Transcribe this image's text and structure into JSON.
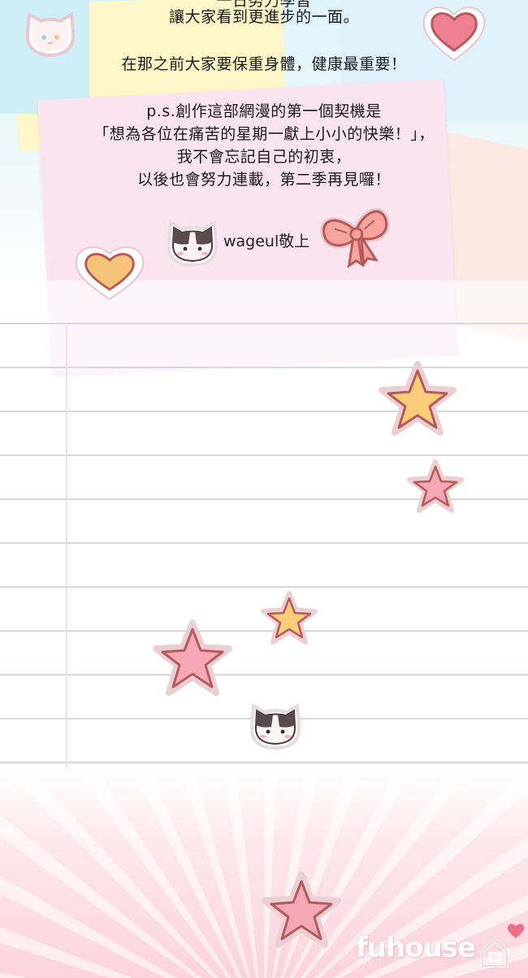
{
  "message": {
    "cut_line": "一日努力學習",
    "line1": "讓大家看到更進步的一面。",
    "line2": "在那之前大家要保重身體，健康最重要！",
    "line3": "p.s.創作這部網漫的第一個契機是",
    "line4": "「想為各位在痛苦的星期一獻上小小的快樂！」，",
    "line5": "我不會忘記自己的初衷，",
    "line6": "以後也會努力連載，第二季再見囉！",
    "signature": "wageul敬上"
  },
  "watermark": {
    "text": "fuhouse"
  },
  "colors": {
    "text": "#1a1a1a",
    "heart_pink": "#ef7f93",
    "heart_orange": "#f6c478",
    "star_yellow": "#f9cd7a",
    "star_pink": "#f6a9b5",
    "sticker_outline": "#b65a5a",
    "paper_line": "#d6d6e4",
    "note_pink": "#f9e4f0"
  },
  "stickers": [
    {
      "icon": "white-cat-face-icon"
    },
    {
      "icon": "heart-icon",
      "color": "pink"
    },
    {
      "icon": "cat-face-icon"
    },
    {
      "icon": "bow-icon"
    },
    {
      "icon": "heart-icon",
      "color": "orange"
    },
    {
      "icon": "star-icon",
      "color": "yellow"
    },
    {
      "icon": "star-icon",
      "color": "pink"
    },
    {
      "icon": "star-icon",
      "color": "yellow"
    },
    {
      "icon": "star-icon",
      "color": "pink"
    },
    {
      "icon": "cat-face-icon"
    },
    {
      "icon": "star-icon",
      "color": "pink"
    }
  ]
}
